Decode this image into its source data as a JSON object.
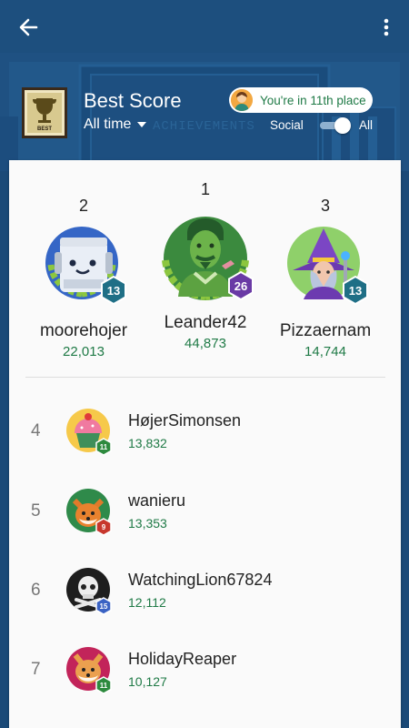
{
  "header": {
    "title": "Best Score",
    "filter": "All time",
    "place_text": "You're in 11th place",
    "social_label": "Social",
    "all_label": "All",
    "trophy_text": "BEST",
    "background_text": "ACHIEVEMENTS"
  },
  "podium": [
    {
      "rank": "2",
      "name": "moorehojer",
      "score": "22,013",
      "level": "13"
    },
    {
      "rank": "1",
      "name": "Leander42",
      "score": "44,873",
      "level": "26"
    },
    {
      "rank": "3",
      "name": "Pizzaernam",
      "score": "14,744",
      "level": "13"
    }
  ],
  "rows": [
    {
      "rank": "4",
      "name": "HøjerSimonsen",
      "score": "13,832",
      "level": "11"
    },
    {
      "rank": "5",
      "name": "wanieru",
      "score": "13,353",
      "level": "9"
    },
    {
      "rank": "6",
      "name": "WatchingLion67824",
      "score": "12,112",
      "level": "15"
    },
    {
      "rank": "7",
      "name": "HolidayReaper",
      "score": "10,127",
      "level": "11"
    }
  ],
  "colors": {
    "appbar": "#1d4f7e",
    "score_green": "#1f7a46",
    "level_teal": "#1f6f86",
    "level_purple": "#6a3aa5",
    "level_red": "#c7372d",
    "level_blue": "#3a62c3",
    "level_green": "#2d8a3e"
  }
}
